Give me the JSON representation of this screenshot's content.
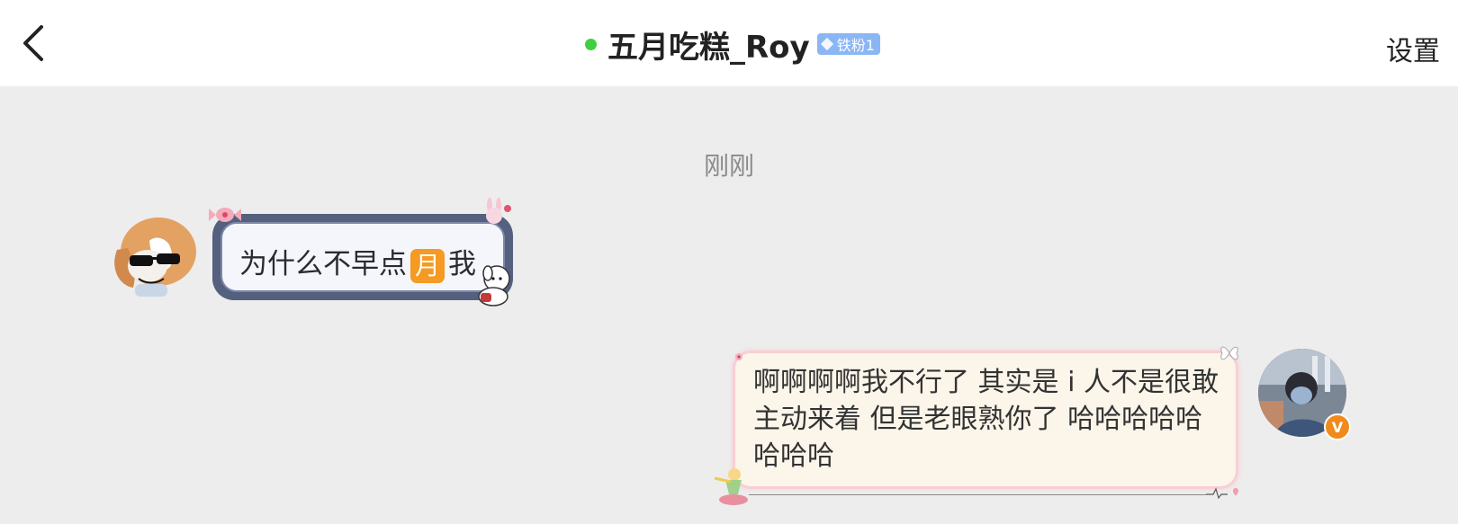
{
  "header": {
    "title": "五月吃糕_Roy",
    "fan_badge": "铁粉1",
    "settings_label": "设置",
    "online": true
  },
  "chat": {
    "timestamp": "刚刚",
    "messages": [
      {
        "side": "left",
        "text_before": "为什么不早点",
        "emoji": "月",
        "text_after": "我"
      },
      {
        "side": "right",
        "text": "啊啊啊啊我不行了 其实是 i 人不是很敢主动来着 但是老眼熟你了 哈哈哈哈哈哈哈哈",
        "verified_badge": "V"
      }
    ]
  },
  "colors": {
    "online_dot": "#3fcf3f",
    "fan_badge": "#8ab6f5",
    "background": "#ededed",
    "left_bubble_frame": "#54607e",
    "right_bubble_fill": "#fcf5ea",
    "verified_badge": "#f08a1c"
  },
  "icons": {
    "back": "chevron-left-icon",
    "online": "online-dot-icon",
    "fan": "diamond-icon"
  }
}
